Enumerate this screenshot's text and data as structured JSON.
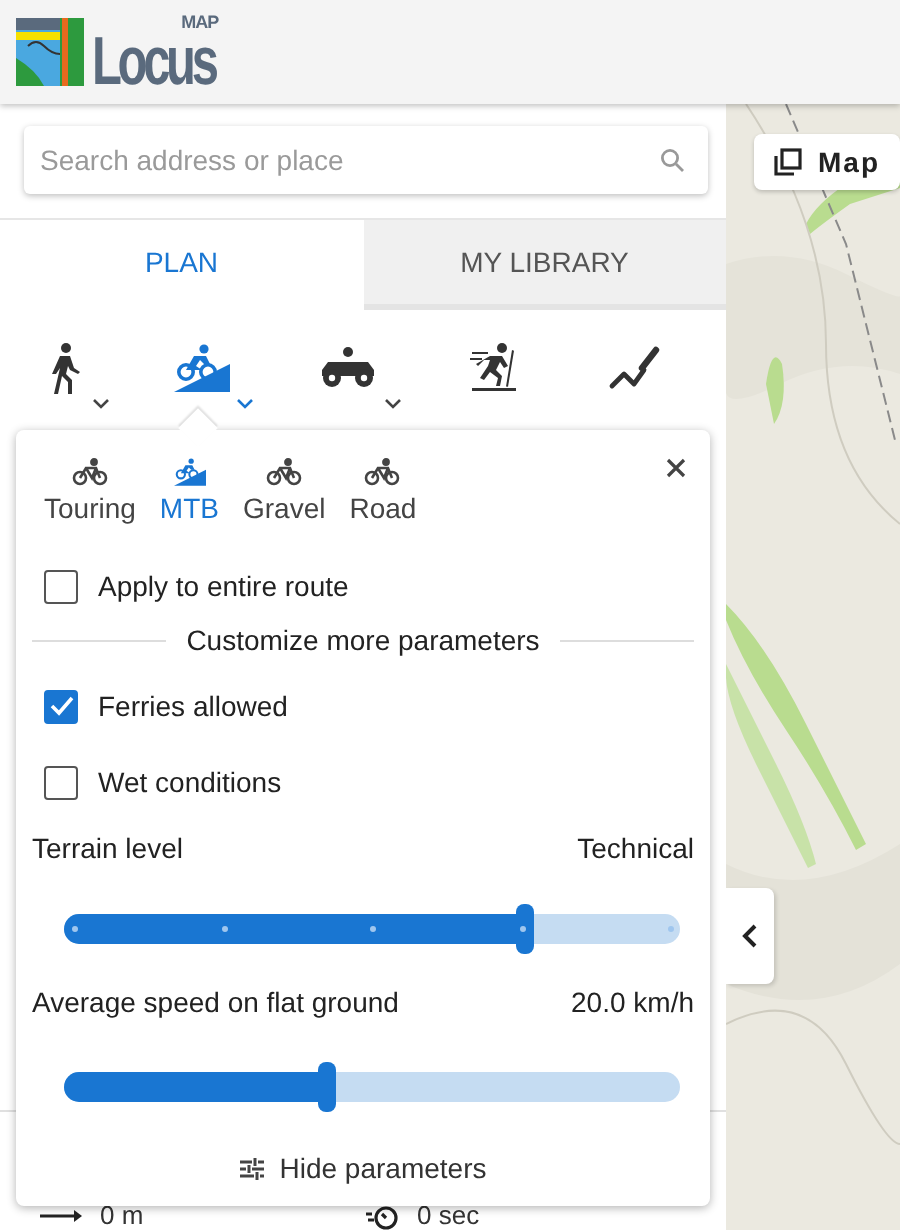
{
  "header": {
    "logo_text": "Locus",
    "logo_badge": "MAP"
  },
  "search": {
    "placeholder": "Search address or place"
  },
  "tabs": [
    {
      "label": "PLAN",
      "selected": true
    },
    {
      "label": "MY LIBRARY",
      "selected": false
    }
  ],
  "modes": [
    {
      "kind": "walk",
      "selected": false,
      "has_menu": true
    },
    {
      "kind": "mtb",
      "selected": true,
      "has_menu": true
    },
    {
      "kind": "moto",
      "selected": false,
      "has_menu": true
    },
    {
      "kind": "ski",
      "selected": false,
      "has_menu": false
    },
    {
      "kind": "draw",
      "selected": false,
      "has_menu": false
    }
  ],
  "profile_card": {
    "profiles": [
      {
        "kind": "touring",
        "label": "Touring",
        "selected": false
      },
      {
        "kind": "mtb",
        "label": "MTB",
        "selected": true
      },
      {
        "kind": "gravel",
        "label": "Gravel",
        "selected": false
      },
      {
        "kind": "road",
        "label": "Road",
        "selected": false
      }
    ],
    "apply_all": {
      "label": "Apply to entire route",
      "checked": false
    },
    "section_title": "Customize more parameters",
    "options": [
      {
        "label": "Ferries allowed",
        "checked": true
      },
      {
        "label": "Wet conditions",
        "checked": false
      }
    ],
    "sliders": [
      {
        "kind": "stepped",
        "label": "Terrain level",
        "reading": "Technical",
        "level": 0.75
      },
      {
        "kind": "continuous",
        "label": "Average speed on flat ground",
        "reading": "20.0 km/h",
        "level": 0.43
      }
    ],
    "toggle_button": "Hide parameters"
  },
  "stats": [
    {
      "kind": "distance",
      "value": "0 m"
    },
    {
      "kind": "time",
      "value": "0 sec"
    }
  ],
  "map": {
    "layer_button": "Map"
  }
}
